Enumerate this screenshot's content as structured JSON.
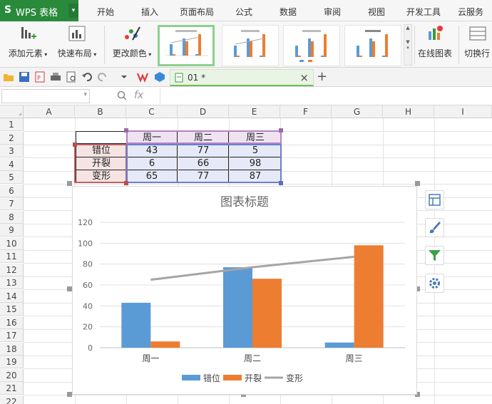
{
  "app": {
    "logo": "S",
    "title": "WPS 表格",
    "menu_arrow": "▾"
  },
  "menu": [
    "开始",
    "插入",
    "页面布局",
    "公式",
    "数据",
    "审阅",
    "视图",
    "开发工具",
    "云服务"
  ],
  "ribbon": {
    "add_element": "添加元素",
    "quick_layout": "快速布局",
    "change_color": "更改颜色",
    "online_chart": "在线图表",
    "switch_row_col": "切换行"
  },
  "document": {
    "tab_label": "01 *",
    "close": "×",
    "new_tab": "+"
  },
  "formula_bar": {
    "fx_label": "fx",
    "value": ""
  },
  "columns": [
    "A",
    "B",
    "C",
    "D",
    "E",
    "F",
    "G",
    "H",
    "I"
  ],
  "rows": [
    "1",
    "2",
    "3",
    "4",
    "5",
    "6",
    "7",
    "8",
    "9",
    "10",
    "11",
    "12",
    "13",
    "14",
    "15",
    "16",
    "17",
    "18",
    "19",
    "20",
    "21",
    "22"
  ],
  "table": {
    "headers": [
      "周一",
      "周二",
      "周三"
    ],
    "row_labels": [
      "错位",
      "开裂",
      "变形"
    ],
    "values": [
      [
        "43",
        "77",
        "5"
      ],
      [
        "6",
        "66",
        "98"
      ],
      [
        "65",
        "77",
        "87"
      ]
    ]
  },
  "colors": {
    "series_1": "#5b9bd5",
    "series_2": "#ed7d31",
    "series_3": "#a5a5a5",
    "accent": "#2a8a3c"
  },
  "chart_data": {
    "type": "bar",
    "title": "图表标题",
    "categories": [
      "周一",
      "周二",
      "周三"
    ],
    "series": [
      {
        "name": "错位",
        "type": "bar",
        "values": [
          43,
          77,
          5
        ]
      },
      {
        "name": "开裂",
        "type": "bar",
        "values": [
          6,
          66,
          98
        ]
      },
      {
        "name": "变形",
        "type": "line",
        "values": [
          65,
          77,
          87
        ]
      }
    ],
    "yticks": [
      "0",
      "20",
      "40",
      "60",
      "80",
      "100",
      "120"
    ],
    "ylim": [
      0,
      120
    ],
    "grid": true,
    "legend": "bottom"
  },
  "side_tools": [
    "chart-elements-icon",
    "chart-style-icon",
    "chart-filter-icon",
    "chart-settings-icon"
  ]
}
